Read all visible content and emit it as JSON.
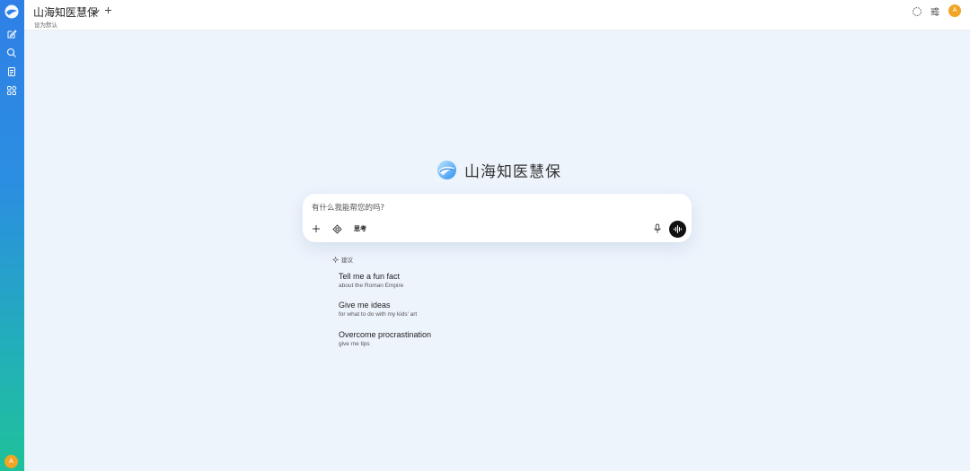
{
  "app": {
    "title": "山海知医慧保",
    "subtitle": "设为默认",
    "avatar_letter": "A"
  },
  "brand": {
    "name": "山海知医慧保"
  },
  "chat": {
    "placeholder": "有什么我能帮您的吗?",
    "think_label": "思考"
  },
  "suggestions": {
    "heading": "建议",
    "items": [
      {
        "title": "Tell me a fun fact",
        "subtitle": "about the Roman Empire"
      },
      {
        "title": "Give me ideas",
        "subtitle": "for what to do with my kids' art"
      },
      {
        "title": "Overcome procrastination",
        "subtitle": "give me tips"
      }
    ]
  },
  "icons": {
    "sidebar": [
      "logo-icon",
      "new-chat-icon",
      "search-icon",
      "notes-icon",
      "apps-icon"
    ],
    "header_right": [
      "loading-icon",
      "settings-sliders-icon"
    ]
  },
  "colors": {
    "sidebar_top": "#2f7fe6",
    "sidebar_bottom": "#1fc19a",
    "avatar": "#f2a524",
    "background": "#eef4fc",
    "send_button": "#111111"
  }
}
